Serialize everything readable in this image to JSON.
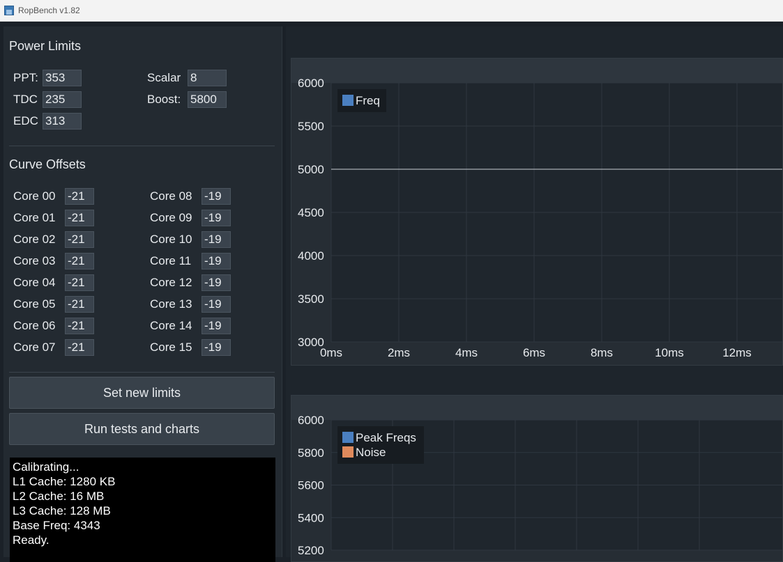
{
  "window": {
    "title": "RopBench v1.82"
  },
  "power_limits": {
    "title": "Power Limits",
    "fields": [
      {
        "label": "PPT:",
        "value": "353"
      },
      {
        "label": "TDC",
        "value": "235"
      },
      {
        "label": "EDC",
        "value": "313"
      },
      {
        "label": "Scalar",
        "value": "8"
      },
      {
        "label": "Boost:",
        "value": "5800"
      }
    ]
  },
  "curve_offsets": {
    "title": "Curve Offsets",
    "cores": [
      {
        "label": "Core 00",
        "value": "-21"
      },
      {
        "label": "Core 01",
        "value": "-21"
      },
      {
        "label": "Core 02",
        "value": "-21"
      },
      {
        "label": "Core 03",
        "value": "-21"
      },
      {
        "label": "Core 04",
        "value": "-21"
      },
      {
        "label": "Core 05",
        "value": "-21"
      },
      {
        "label": "Core 06",
        "value": "-21"
      },
      {
        "label": "Core 07",
        "value": "-21"
      },
      {
        "label": "Core 08",
        "value": "-19"
      },
      {
        "label": "Core 09",
        "value": "-19"
      },
      {
        "label": "Core 10",
        "value": "-19"
      },
      {
        "label": "Core 11",
        "value": "-19"
      },
      {
        "label": "Core 12",
        "value": "-19"
      },
      {
        "label": "Core 13",
        "value": "-19"
      },
      {
        "label": "Core 14",
        "value": "-19"
      },
      {
        "label": "Core 15",
        "value": "-19"
      }
    ]
  },
  "buttons": {
    "set_limits": "Set new limits",
    "run_tests": "Run tests and charts"
  },
  "console": {
    "lines": [
      "Calibrating...",
      "L1 Cache: 1280 KB",
      "L2 Cache: 16 MB",
      "L3 Cache: 128 MB",
      "Base Freq: 4343",
      "Ready."
    ]
  },
  "chart_data": [
    {
      "type": "line",
      "title": "",
      "xlabel": "",
      "ylabel": "",
      "ylim": [
        3000,
        6000
      ],
      "yticks": [
        6000,
        5500,
        5000,
        4500,
        4000,
        3500,
        3000
      ],
      "xticks": [
        "0ms",
        "2ms",
        "4ms",
        "6ms",
        "8ms",
        "10ms",
        "12ms"
      ],
      "grid": true,
      "legend_position": "top-left",
      "series": [
        {
          "name": "Freq",
          "color": "#4a7fc0",
          "x": [
            0,
            13.5
          ],
          "y": [
            5000,
            5000
          ]
        }
      ]
    },
    {
      "type": "line",
      "title": "",
      "xlabel": "",
      "ylabel": "",
      "ylim": [
        5200,
        6000
      ],
      "yticks": [
        6000,
        5800,
        5600,
        5400,
        5200
      ],
      "grid": true,
      "legend_position": "top-left",
      "series": [
        {
          "name": "Peak Freqs",
          "color": "#4a7fc0",
          "values": []
        },
        {
          "name": "Noise",
          "color": "#e08a5c",
          "values": []
        }
      ]
    }
  ]
}
